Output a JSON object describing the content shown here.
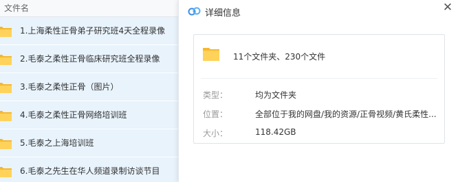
{
  "list": {
    "header": "文件名",
    "items": [
      {
        "name": "1.上海柔性正骨弟子研究班4天全程录像"
      },
      {
        "name": "2.毛泰之柔性正骨临床研究班全程录像"
      },
      {
        "name": "3.毛泰之柔性正骨（图片）"
      },
      {
        "name": "4.毛泰之柔性正骨网络培训班"
      },
      {
        "name": "5.毛泰之上海培训班"
      },
      {
        "name": "6.毛泰之先生在华人频道录制访谈节目"
      }
    ]
  },
  "detail": {
    "title": "详细信息",
    "close_glyph": "✕",
    "summary": "11个文件夹、230个文件",
    "props": [
      {
        "label": "类型：",
        "value": "均为文件夹"
      },
      {
        "label": "位置：",
        "value": "全部位于我的网盘/我的资源/正骨视频/黄氏柔性..."
      },
      {
        "label": "大小：",
        "value": "118.42GB"
      }
    ]
  },
  "colors": {
    "list_bg": "#e8f3fc",
    "folder_yellow": "#ffc83d",
    "logo_blue": "#3a8ee6"
  },
  "icons": {
    "folder": "folder-icon",
    "logo": "cloud-logo-icon",
    "close": "close-icon"
  }
}
